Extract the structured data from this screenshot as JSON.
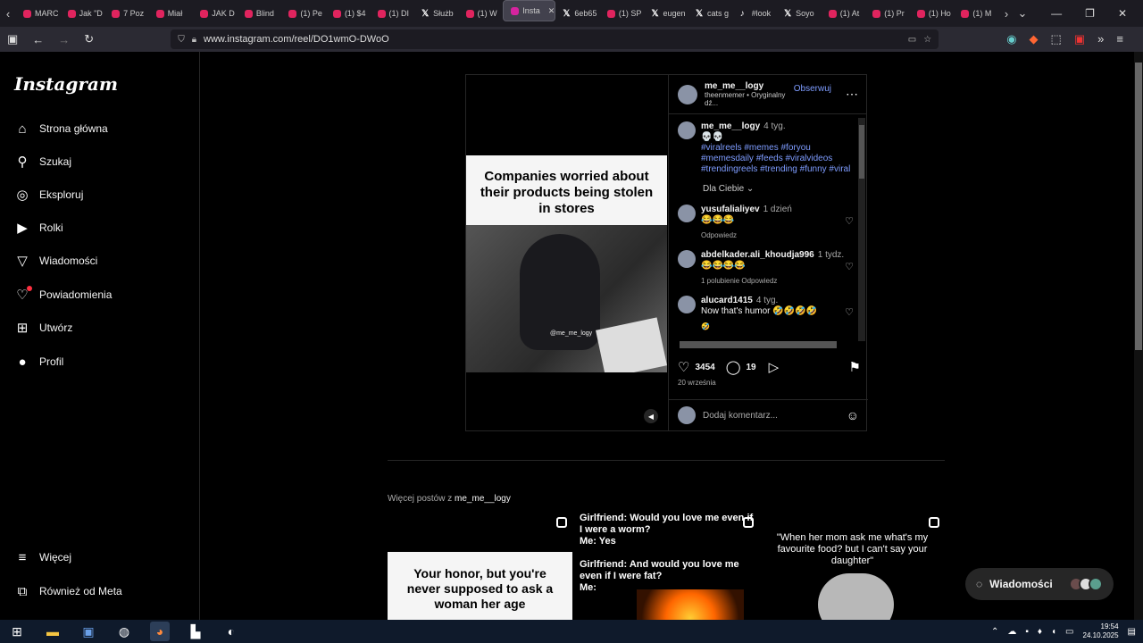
{
  "browser": {
    "tabs": [
      {
        "label": "MARC",
        "icon": "youtube-icon"
      },
      {
        "label": "Jak \"D",
        "icon": "youtube-icon"
      },
      {
        "label": "7 Poz",
        "icon": "youtube-icon"
      },
      {
        "label": "Miał",
        "icon": "youtube-icon"
      },
      {
        "label": "JAK D",
        "icon": "youtube-icon"
      },
      {
        "label": "Blind",
        "icon": "youtube-icon"
      },
      {
        "label": "(1) Pe",
        "icon": "youtube-icon"
      },
      {
        "label": "(1) $4",
        "icon": "youtube-icon"
      },
      {
        "label": "(1) DI",
        "icon": "youtube-icon"
      },
      {
        "label": "Służb",
        "icon": "x-icon"
      },
      {
        "label": "(1) W",
        "icon": "youtube-icon"
      },
      {
        "label": "Insta",
        "icon": "instagram-icon",
        "active": true
      },
      {
        "label": "6eb65",
        "icon": "x-icon"
      },
      {
        "label": "(1) SP",
        "icon": "youtube-icon"
      },
      {
        "label": "eugen",
        "icon": "x-icon"
      },
      {
        "label": "cats g",
        "icon": "x-icon"
      },
      {
        "label": "#look",
        "icon": "tiktok-icon"
      },
      {
        "label": "Soyo",
        "icon": "x-icon"
      },
      {
        "label": "(1) At",
        "icon": "youtube-icon"
      },
      {
        "label": "(1) Pr",
        "icon": "youtube-icon"
      },
      {
        "label": "(1) Ho",
        "icon": "youtube-icon"
      },
      {
        "label": "(1) M",
        "icon": "youtube-icon"
      }
    ],
    "url": "www.instagram.com/reel/DO1wmO-DWoO"
  },
  "sidebar": {
    "logo": "Instagram",
    "items": [
      {
        "label": "Strona główna",
        "icon": "home-icon"
      },
      {
        "label": "Szukaj",
        "icon": "search-icon"
      },
      {
        "label": "Eksploruj",
        "icon": "explore-icon"
      },
      {
        "label": "Rolki",
        "icon": "reels-icon"
      },
      {
        "label": "Wiadomości",
        "icon": "messages-icon"
      },
      {
        "label": "Powiadomienia",
        "icon": "heart-icon"
      },
      {
        "label": "Utwórz",
        "icon": "create-icon"
      },
      {
        "label": "Profil",
        "icon": "avatar-icon"
      }
    ],
    "more": "Więcej",
    "meta": "Również od Meta"
  },
  "post": {
    "caption_overlay": "Companies worried about their products being stolen in stores",
    "watermark": "@me_me_logy",
    "author": "me_me__logy",
    "follow": "Obserwuj",
    "audio": "theenmemer • Oryginalny dź...",
    "caption": {
      "author": "me_me__logy",
      "time": "4 tyg.",
      "emoji": "💀💀",
      "tags": "#viralreels #memes #foryou #memesdaily #feeds #viralvideos #trendingreels #trending #funny #viral"
    },
    "for_you": "Dla Ciebie",
    "comments": [
      {
        "user": "yusufalialiyev",
        "time": "1 dzień",
        "text": "😂😂😂",
        "meta": "Odpowiedz"
      },
      {
        "user": "abdelkader.ali_khoudja996",
        "time": "1 tydz.",
        "text": "😂😂😂😂",
        "meta": "1 polubienie   Odpowiedz"
      },
      {
        "user": "alucard1415",
        "time": "4 tyg.",
        "text": "Now that's humor 🤣🤣🤣🤣",
        "meta": "🤣"
      }
    ],
    "likes": "3454",
    "comment_count": "19",
    "date": "20 września",
    "add_comment_placeholder": "Dodaj komentarz..."
  },
  "more_posts": {
    "label_prefix": "Więcej postów z",
    "label_user": "me_me__logy",
    "items": [
      {
        "text": "Your honor, but you're never supposed to ask a woman her age"
      },
      {
        "text": "Girlfriend: Would you love me even if I were a worm?\nMe: Yes\n\nGirlfriend: And would you love me even if I were fat?\nMe:"
      },
      {
        "text": "\"When her mom ask me what's my favourite food? but I can't say your daughter\""
      }
    ]
  },
  "messages_pill": "Wiadomości",
  "taskbar": {
    "time": "19:54",
    "date": "24.10.2025"
  }
}
